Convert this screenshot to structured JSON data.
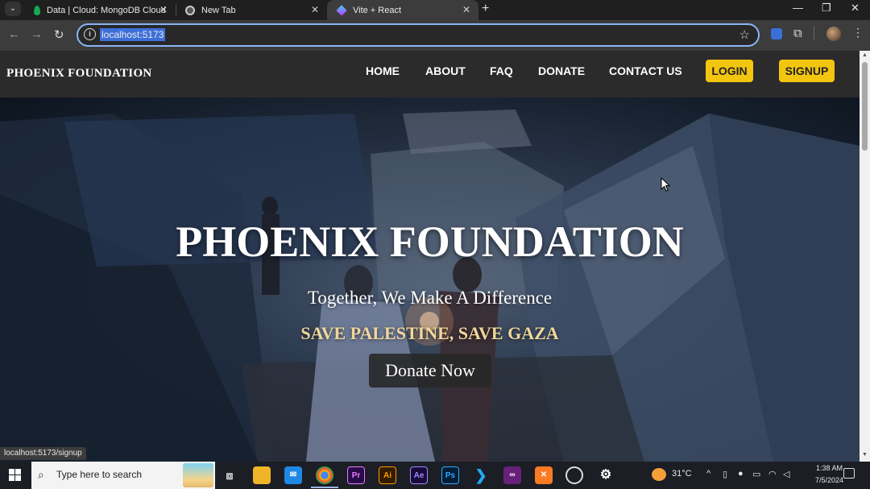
{
  "browser": {
    "tabs": [
      {
        "label": "Data | Cloud: MongoDB Cloud",
        "icon": "mongodb-leaf-icon",
        "active": false
      },
      {
        "label": "New Tab",
        "icon": "chrome-icon",
        "active": false
      },
      {
        "label": "Vite + React",
        "icon": "vite-icon",
        "active": true
      }
    ],
    "url": "localhost:5173",
    "status_url": "localhost:5173/signup"
  },
  "site": {
    "brand": "PHOENIX FOUNDATION",
    "nav": {
      "home": "HOME",
      "about": "ABOUT",
      "faq": "FAQ",
      "donate": "DONATE",
      "contact": "CONTACT US",
      "login": "LOGIN",
      "signup": "SIGNUP"
    },
    "hero": {
      "title": "PHOENIX FOUNDATION",
      "subtitle": "Together, We Make A Difference",
      "cause": "SAVE PALESTINE, SAVE GAZA",
      "cta": "Donate Now"
    }
  },
  "colors": {
    "accent_button": "#f2c50f",
    "navbar": "#2b2b2b",
    "cause_text": "#f0d79b"
  },
  "taskbar": {
    "search_placeholder": "Type here to search",
    "weather": "31°C",
    "time": "1:38 AM",
    "date": "7/5/2024"
  }
}
